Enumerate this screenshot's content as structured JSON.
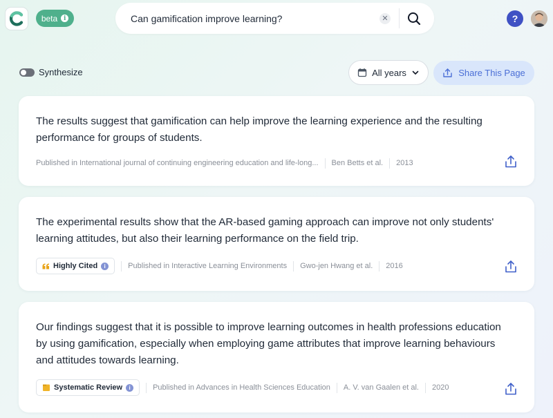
{
  "header": {
    "beta_label": "beta",
    "search_value": "Can gamification improve learning?",
    "help_label": "?"
  },
  "toolbar": {
    "synthesize_label": "Synthesize",
    "synthesize_on": false,
    "years_label": "All years",
    "share_label": "Share This Page"
  },
  "results": [
    {
      "text": "The results suggest that gamification can help improve the learning experience and the resulting performance for groups of students.",
      "badge": "",
      "published": "Published in International journal of continuing engineering education and life-long...",
      "authors": "Ben Betts et al.",
      "year": "2013"
    },
    {
      "text": "The experimental results show that the AR-based gaming approach can improve not only students' learning attitudes, but also their learning performance on the field trip.",
      "badge": "Highly Cited",
      "published": "Published in Interactive Learning Environments",
      "authors": "Gwo-jen Hwang et al.",
      "year": "2016"
    },
    {
      "text": "Our findings suggest that it is possible to improve learning outcomes in health professions education by using gamification, especially when employing game attributes that improve learning behaviours and attitudes towards learning.",
      "badge": "Systematic Review",
      "published": "Published in Advances in Health Sciences Education",
      "authors": "A. V. van Gaalen et al.",
      "year": "2020"
    }
  ],
  "colors": {
    "accent": "#4fb08c",
    "share_bg": "#d9e6fb",
    "share_text": "#4b6fd6",
    "help": "#3f51c4"
  },
  "icons": {
    "logo": "consensus-logo-icon",
    "search": "search-icon",
    "clear": "clear-icon",
    "calendar": "calendar-icon",
    "chevron": "chevron-down-icon",
    "share": "share-icon",
    "upload": "upload-icon",
    "quote": "quote-icon",
    "review": "document-icon"
  }
}
